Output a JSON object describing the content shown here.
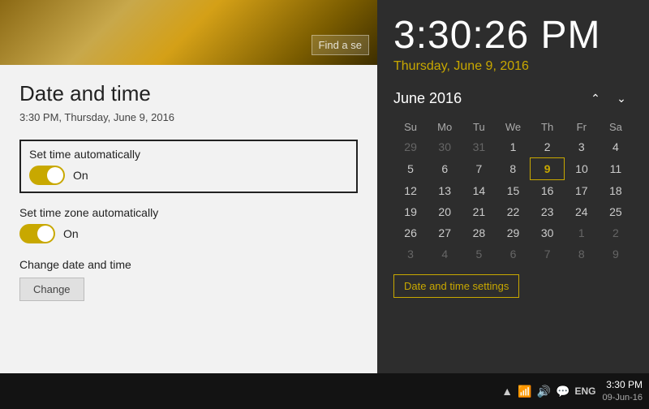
{
  "settings": {
    "title": "Date and time",
    "current_datetime": "3:30 PM, Thursday, June 9, 2016",
    "search_placeholder": "Find a se",
    "set_time_auto": {
      "label": "Set time automatically",
      "state": "On"
    },
    "set_timezone_auto": {
      "label": "Set time zone automatically",
      "state": "On"
    },
    "change_section": {
      "label": "Change date and time",
      "button": "Change"
    }
  },
  "clock": {
    "time": "3:30:26 PM",
    "date": "Thursday, June 9, 2016",
    "calendar": {
      "month_year": "June 2016",
      "weekdays": [
        "Su",
        "Mo",
        "Tu",
        "We",
        "Th",
        "Fr",
        "Sa"
      ],
      "weeks": [
        [
          "29",
          "30",
          "31",
          "1",
          "2",
          "3",
          "4"
        ],
        [
          "5",
          "6",
          "7",
          "8",
          "9",
          "10",
          "11"
        ],
        [
          "12",
          "13",
          "14",
          "15",
          "16",
          "17",
          "18"
        ],
        [
          "19",
          "20",
          "21",
          "22",
          "23",
          "24",
          "25"
        ],
        [
          "26",
          "27",
          "28",
          "29",
          "30",
          "1",
          "2"
        ],
        [
          "3",
          "4",
          "5",
          "6",
          "7",
          "8",
          "9"
        ]
      ],
      "other_month_days": [
        "29",
        "30",
        "31",
        "1",
        "2",
        "29",
        "30",
        "1",
        "2",
        "3",
        "4",
        "5",
        "6",
        "7",
        "8",
        "9"
      ],
      "today": "9",
      "today_week": 1,
      "today_col": 4
    },
    "settings_link": "Date and time settings"
  },
  "taskbar": {
    "time": "3:30 PM",
    "date": "09-Jun-16",
    "lang": "ENG",
    "icons": [
      "▲",
      "🔊",
      "📶",
      "💬"
    ]
  }
}
